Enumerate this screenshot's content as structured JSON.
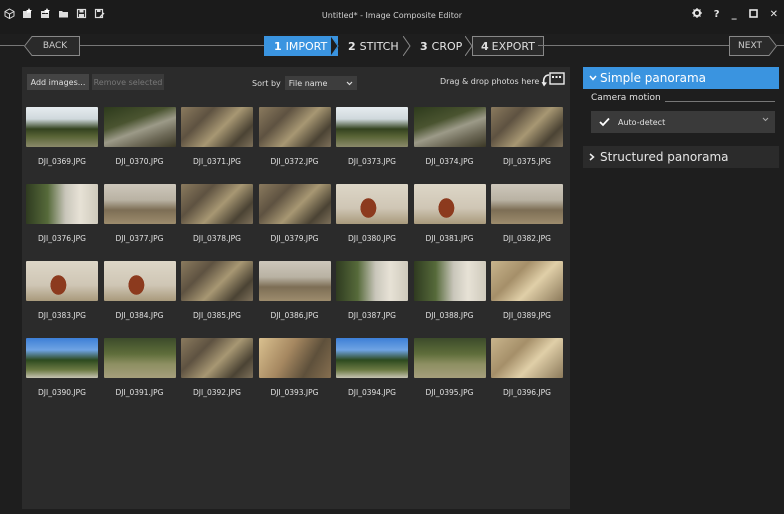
{
  "window": {
    "title": "Untitled* - Image Composite Editor",
    "toolbar_icons": [
      "cube-icon",
      "new-panorama-icon",
      "new-panorama-video-icon",
      "open-folder-icon",
      "save-icon",
      "save-as-icon"
    ],
    "right_icons": [
      "settings-gear-icon",
      "help-icon",
      "minimize-icon",
      "maximize-icon",
      "close-icon"
    ],
    "help": "?",
    "minimize": "_",
    "close": "✕"
  },
  "nav": {
    "back": "BACK",
    "next": "NEXT",
    "steps": [
      {
        "num": "1",
        "label": "IMPORT"
      },
      {
        "num": "2",
        "label": "STITCH"
      },
      {
        "num": "3",
        "label": "CROP"
      },
      {
        "num": "4",
        "label": "EXPORT"
      }
    ],
    "active_step": 0
  },
  "import": {
    "add_images": "Add images...",
    "remove_selected": "Remove selected",
    "sort_by_label": "Sort by",
    "sort_value": "File name",
    "drag_drop": "Drag & drop photos here"
  },
  "photos": [
    {
      "name": "DJI_0369.JPG",
      "scene": "trees-sky"
    },
    {
      "name": "DJI_0370.JPG",
      "scene": "path-shade"
    },
    {
      "name": "DJI_0371.JPG",
      "scene": "ground-shade"
    },
    {
      "name": "DJI_0372.JPG",
      "scene": "ground-shade"
    },
    {
      "name": "DJI_0373.JPG",
      "scene": "trees-sky"
    },
    {
      "name": "DJI_0374.JPG",
      "scene": "path-shade"
    },
    {
      "name": "DJI_0375.JPG",
      "scene": "ground-shade"
    },
    {
      "name": "DJI_0376.JPG",
      "scene": "trees-wall"
    },
    {
      "name": "DJI_0377.JPG",
      "scene": "wall-ground"
    },
    {
      "name": "DJI_0378.JPG",
      "scene": "ground-shade"
    },
    {
      "name": "DJI_0379.JPG",
      "scene": "ground-shade"
    },
    {
      "name": "DJI_0380.JPG",
      "scene": "wall-door"
    },
    {
      "name": "DJI_0381.JPG",
      "scene": "wall-door"
    },
    {
      "name": "DJI_0382.JPG",
      "scene": "wall-ground"
    },
    {
      "name": "DJI_0383.JPG",
      "scene": "wall-door"
    },
    {
      "name": "DJI_0384.JPG",
      "scene": "wall-door"
    },
    {
      "name": "DJI_0385.JPG",
      "scene": "ground-shade"
    },
    {
      "name": "DJI_0386.JPG",
      "scene": "wall-ground"
    },
    {
      "name": "DJI_0387.JPG",
      "scene": "trees-wall"
    },
    {
      "name": "DJI_0388.JPG",
      "scene": "trees-wall"
    },
    {
      "name": "DJI_0389.JPG",
      "scene": "ground-bright"
    },
    {
      "name": "DJI_0390.JPG",
      "scene": "trees-blue"
    },
    {
      "name": "DJI_0391.JPG",
      "scene": "park-grass"
    },
    {
      "name": "DJI_0392.JPG",
      "scene": "ground-shade"
    },
    {
      "name": "DJI_0393.JPG",
      "scene": "ground-sun"
    },
    {
      "name": "DJI_0394.JPG",
      "scene": "trees-blue"
    },
    {
      "name": "DJI_0395.JPG",
      "scene": "park-grass"
    },
    {
      "name": "DJI_0396.JPG",
      "scene": "ground-bright"
    }
  ],
  "panel": {
    "simple_panorama": "Simple panorama",
    "camera_motion_label": "Camera motion",
    "camera_motion_value": "Auto-detect",
    "structured_panorama": "Structured panorama"
  },
  "colors": {
    "accent": "#3a94e0",
    "background": "#1e1e1e",
    "panel": "#2b2b2b"
  }
}
